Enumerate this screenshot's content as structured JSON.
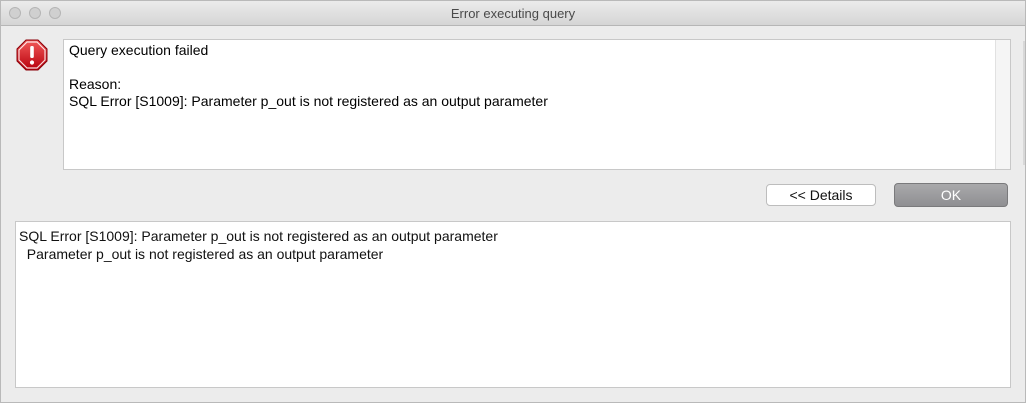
{
  "window": {
    "title": "Error executing query"
  },
  "alert": {
    "icon": "error-octagon-icon",
    "color": "#d0021b",
    "message_lines": [
      "Query execution failed",
      "",
      "Reason:",
      "SQL Error [S1009]: Parameter p_out is not registered as an output parameter"
    ]
  },
  "buttons": {
    "details_label": "<< Details",
    "ok_label": "OK"
  },
  "details": {
    "lines": [
      "SQL Error [S1009]: Parameter p_out is not registered as an output parameter",
      "  Parameter p_out is not registered as an output parameter"
    ]
  }
}
